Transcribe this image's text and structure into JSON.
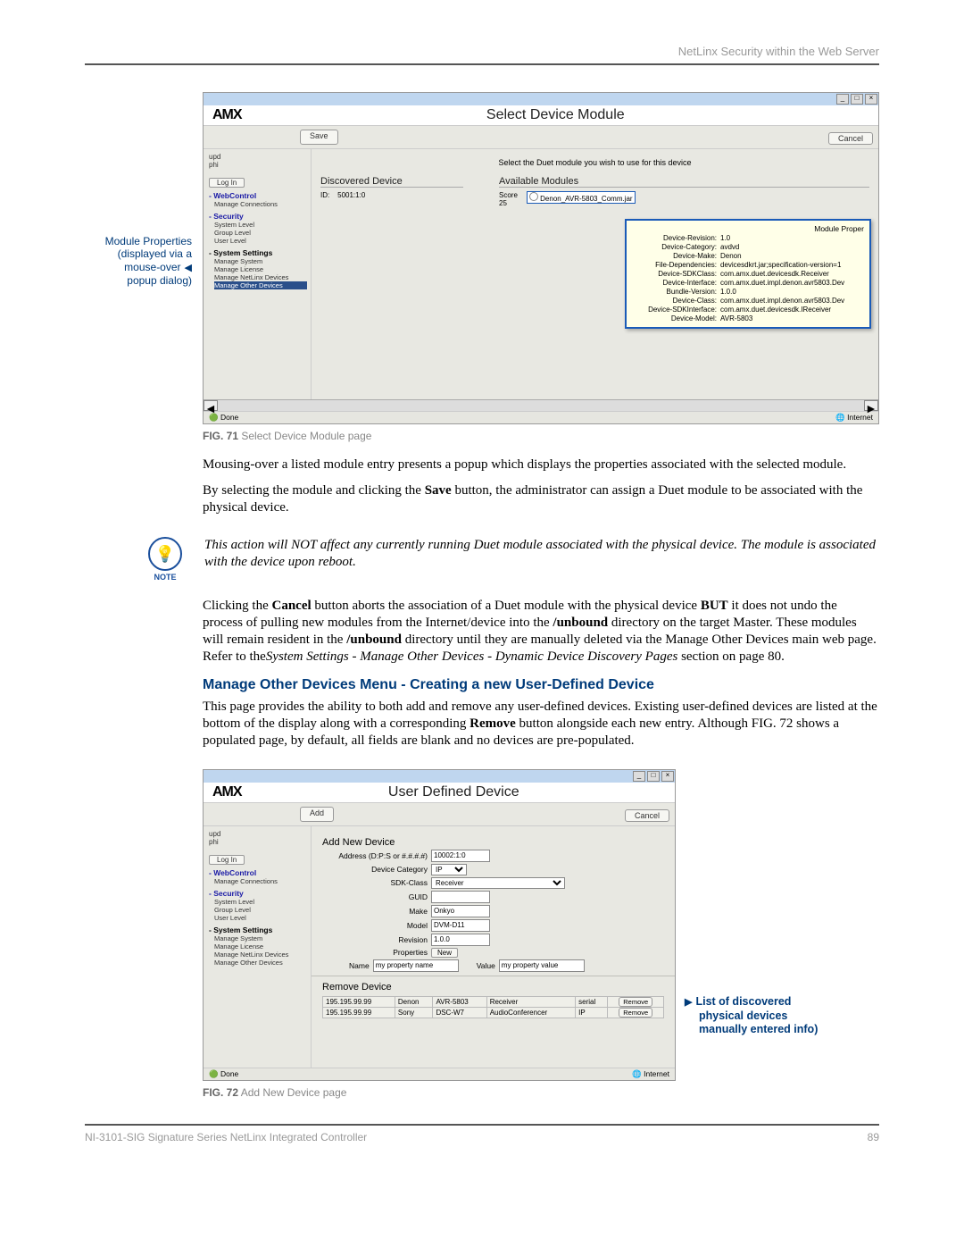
{
  "header_right": "NetLinx Security within the Web Server",
  "callout1_l1": "Module Properties",
  "callout1_l2": "(displayed via a",
  "callout1_l3": "mouse-over",
  "callout1_l4": "popup dialog)",
  "fig71": {
    "title": "Select Device Module",
    "save": "Save",
    "cancel": "Cancel",
    "instr": "Select the Duet module you wish to use for this device",
    "login": "Log In",
    "side_upd_l1": "upd",
    "side_upd_l2": "phi",
    "side1": "WebControl",
    "side1a": "Manage Connections",
    "side2": "Security",
    "side2a": "System Level",
    "side2b": "Group Level",
    "side2c": "User Level",
    "side3": "System Settings",
    "side3a": "Manage System",
    "side3b": "Manage License",
    "side3c": "Manage NetLinx Devices",
    "side3d": "Manage Other Devices",
    "col1h": "Discovered Device",
    "col1_idlbl": "ID:",
    "col1_idval": "5001:1:0",
    "col2h": "Available Modules",
    "col2_score": "Score",
    "col2_score_v": "25",
    "col2_modline": "Denon_AVR-5803_Comm.jar",
    "pop_title": "Module Proper",
    "pop_k1": "Device-Revision:",
    "pop_v1": "1.0",
    "pop_k2": "Device-Category:",
    "pop_v2": "avdvd",
    "pop_k3": "Device-Make:",
    "pop_v3": "Denon",
    "pop_k4": "File-Dependencies:",
    "pop_v4": "devicesdkrt.jar;specification-version=1",
    "pop_k5": "Device-SDKClass:",
    "pop_v5": "com.amx.duet.devicesdk.Receiver",
    "pop_k6": "Device-Interface:",
    "pop_v6": "com.amx.duet.impl.denon.avr5803.Dev",
    "pop_k7": "Bundle-Version:",
    "pop_v7": "1.0.0",
    "pop_k8": "Device-Class:",
    "pop_v8": "com.amx.duet.impl.denon.avr5803.Dev",
    "pop_k9": "Device-SDKInterface:",
    "pop_v9": "com.amx.duet.devicesdk.IReceiver",
    "pop_k10": "Device-Model:",
    "pop_v10": "AVR-5803",
    "status_done": "Done",
    "status_inet": "Internet",
    "caption_b": "FIG. 71",
    "caption_t": "  Select Device Module page"
  },
  "p1": "Mousing-over a listed module entry presents a popup which displays the properties associated with the selected module.",
  "p2a": "By selecting the module and clicking the ",
  "p2b": "Save",
  "p2c": " button, the administrator can assign a Duet module to be associated with the physical device.",
  "note_label": "NOTE",
  "note_text": "This action will NOT affect any currently running Duet module associated with the physical device. The module is associated with the device upon reboot.",
  "p3a": "Clicking the ",
  "p3b": "Cancel",
  "p3c": " button aborts the association of a Duet module with the physical device ",
  "p3d": "BUT",
  "p3e": " it does not undo the process of pulling new modules from the Internet/device into the ",
  "p3f": "/unbound",
  "p3g": " directory on the target Master. These modules will remain resident in the ",
  "p3h": "/unbound",
  "p3i": " directory until they are manually deleted via the Manage Other Devices main web page. Refer to the",
  "p3j": "System Settings - Manage Other Devices - Dynamic Device Discovery Pages",
  "p3k": " section on page 80.",
  "section_h": "Manage Other Devices Menu - Creating a new User-Defined Device",
  "p4a": "This page provides the ability to both add and remove any user-defined devices. Existing user-defined devices are listed at the bottom of the display along with a corresponding ",
  "p4b": "Remove",
  "p4c": " button alongside each new entry. Although FIG. 72 shows a populated page, by default, all fields are blank and no devices are pre-populated.",
  "fig72": {
    "title": "User Defined Device",
    "add": "Add",
    "cancel": "Cancel",
    "grp_add": "Add New Device",
    "lbl_addr": "Address (D:P:S or #.#.#.#)",
    "val_addr": "10002:1:0",
    "lbl_cat": "Device Category",
    "val_cat": "IP",
    "lbl_sdk": "SDK-Class",
    "val_sdk": "Receiver",
    "lbl_guid": "GUID",
    "lbl_make": "Make",
    "val_make": "Onkyo",
    "lbl_model": "Model",
    "val_model": "DVM-D11",
    "lbl_rev": "Revision",
    "val_rev": "1.0.0",
    "lbl_props": "Properties",
    "btn_new": "New",
    "lbl_pname": "Name",
    "val_pname": "my property name",
    "lbl_pval": "Value",
    "val_pval": "my property value",
    "grp_rm": "Remove Device",
    "row1_c1": "195.195.99.99",
    "row1_c2": "Denon",
    "row1_c3": "AVR-5803",
    "row1_c4": "Receiver",
    "row1_c5": "serial",
    "row2_c1": "195.195.99.99",
    "row2_c2": "Sony",
    "row2_c3": "DSC-W7",
    "row2_c4": "AudioConferencer",
    "row2_c5": "IP",
    "remove": "Remove",
    "caption_b": "FIG. 72",
    "caption_t": "  Add New Device page"
  },
  "callout2_l1": "List of discovered",
  "callout2_l2": "physical devices",
  "callout2_l3": "manually entered info)",
  "footer_left": "NI-3101-SIG Signature Series NetLinx Integrated Controller",
  "footer_page": "89"
}
